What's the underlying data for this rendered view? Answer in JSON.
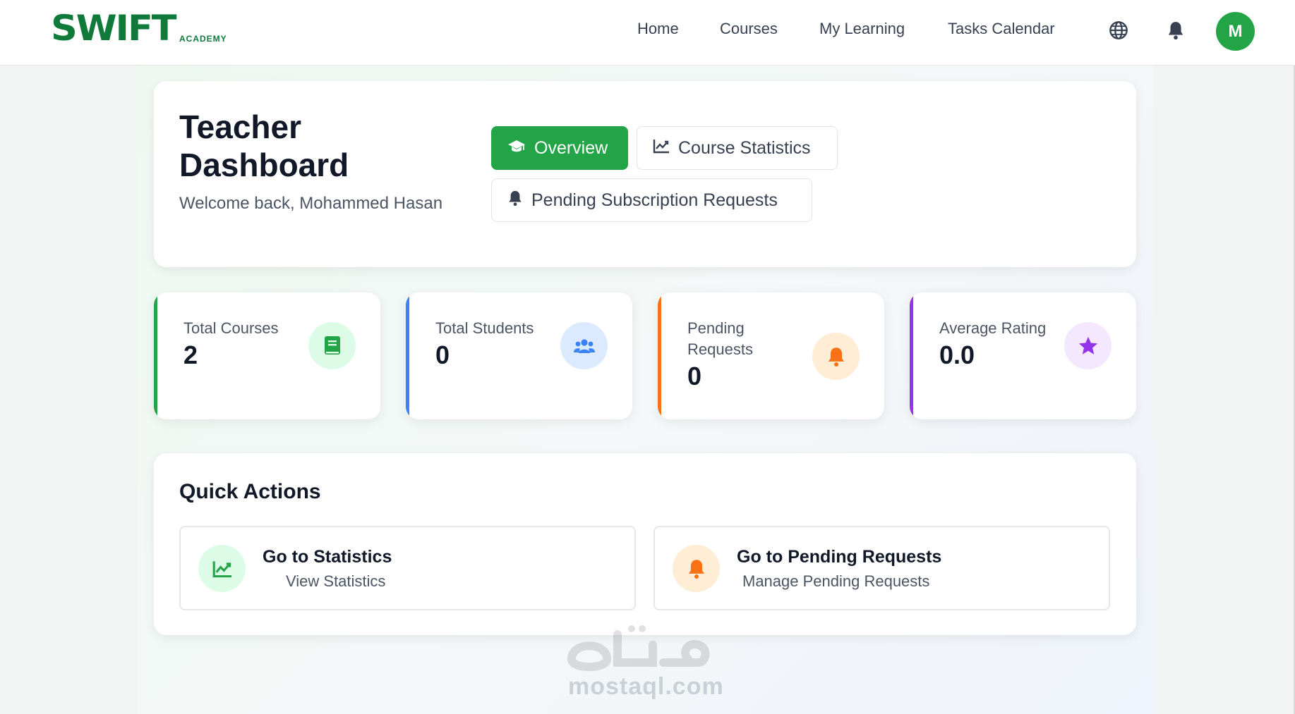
{
  "brand": {
    "name": "SWIFT",
    "sub": "ACADEMY",
    "color": "#0f7a3a"
  },
  "nav": {
    "home": "Home",
    "courses": "Courses",
    "my_learning": "My Learning",
    "tasks_calendar": "Tasks Calendar"
  },
  "header_icons": [
    "globe-icon",
    "bell-icon"
  ],
  "user": {
    "initial": "M"
  },
  "dashboard": {
    "title": "Teacher Dashboard",
    "welcome": "Welcome back, Mohammed Hasan",
    "tabs": {
      "overview": "Overview",
      "course_statistics": "Course Statistics",
      "pending_requests": "Pending Subscription Requests"
    }
  },
  "stats": [
    {
      "label": "Total Courses",
      "value": "2",
      "color": "#22a447",
      "icon": "book-icon"
    },
    {
      "label": "Total Students",
      "value": "0",
      "color": "#3b82f6",
      "icon": "users-icon"
    },
    {
      "label": "Pending Requests",
      "value": "0",
      "color": "#f97316",
      "icon": "bell-icon"
    },
    {
      "label": "Average Rating",
      "value": "0.0",
      "color": "#9333ea",
      "icon": "star-icon"
    }
  ],
  "quick_actions": {
    "title": "Quick Actions",
    "items": [
      {
        "title": "Go to Statistics",
        "desc": "View Statistics",
        "icon": "chart-icon"
      },
      {
        "title": "Go to Pending Requests",
        "desc": "Manage Pending Requests",
        "icon": "bell-icon"
      }
    ]
  },
  "watermark": {
    "text": "mostaql.com"
  },
  "colors": {
    "primary": "#22a447",
    "blue": "#3b82f6",
    "orange": "#f97316",
    "purple": "#9333ea"
  }
}
